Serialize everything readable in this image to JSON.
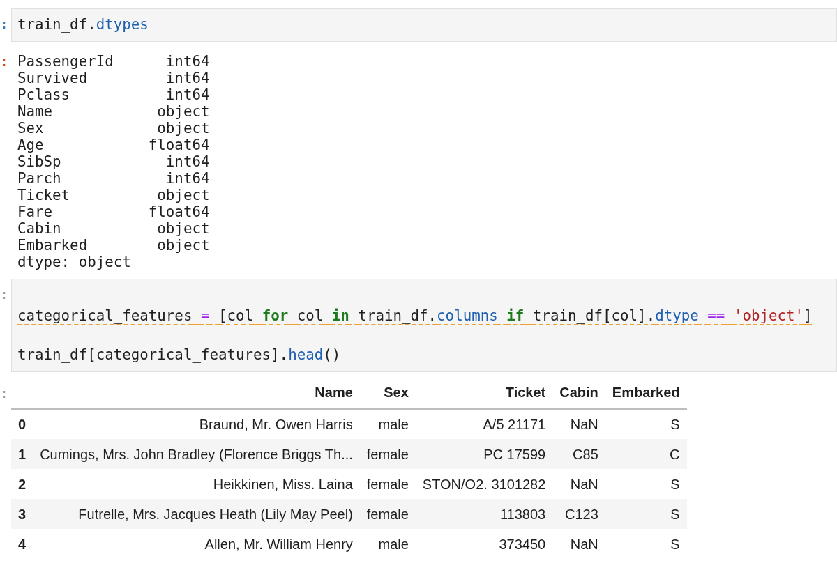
{
  "cells": [
    {
      "kind": "code",
      "prompt": ":",
      "color": "#307fc1",
      "lines": [
        {
          "lint_warning": false,
          "tokens": [
            {
              "kind": "plain",
              "text": "train_df."
            },
            {
              "kind": "attr",
              "text": "dtypes"
            }
          ]
        }
      ]
    },
    {
      "kind": "text_output",
      "prompt": ":",
      "color": "#d84315",
      "lines": [
        "PassengerId      int64",
        "Survived         int64",
        "Pclass           int64",
        "Name            object",
        "Sex             object",
        "Age            float64",
        "SibSp            int64",
        "Parch            int64",
        "Ticket          object",
        "Fare           float64",
        "Cabin           object",
        "Embarked        object",
        "dtype: object"
      ]
    },
    {
      "kind": "code",
      "prompt": ":",
      "color": "#9e9e9e",
      "lines": [
        {
          "blank_line_before": true,
          "lint_warning": true,
          "tokens": [
            {
              "kind": "plain",
              "text": "categorical_features",
              "space_after": true
            },
            {
              "kind": "operator",
              "text": "=",
              "space_after": true
            },
            {
              "kind": "plain",
              "text": "[col",
              "space_after": true
            },
            {
              "kind": "keyword",
              "text": "for",
              "space_after": true
            },
            {
              "kind": "plain",
              "text": "col",
              "space_after": true
            },
            {
              "kind": "keyword",
              "text": "in",
              "space_after": true
            },
            {
              "kind": "plain",
              "text": "train_df."
            },
            {
              "kind": "attr",
              "text": "columns",
              "space_after": true
            },
            {
              "kind": "keyword",
              "text": "if",
              "space_after": true
            },
            {
              "kind": "plain",
              "text": "train_df[col]."
            },
            {
              "kind": "attr",
              "text": "dtype",
              "space_after": true
            },
            {
              "kind": "operator",
              "text": "==",
              "space_after": true
            },
            {
              "kind": "string",
              "text": "'object'"
            },
            {
              "kind": "plain",
              "text": "]"
            }
          ]
        },
        {
          "blank_line_before": true,
          "lint_warning": false,
          "tokens": [
            {
              "kind": "plain",
              "text": "train_df[categorical_features]."
            },
            {
              "kind": "attr",
              "text": "head"
            },
            {
              "kind": "plain",
              "text": "()"
            }
          ]
        }
      ]
    },
    {
      "kind": "table_output",
      "prompt": ":",
      "color": "#9e9e9e",
      "columns": [
        "Name",
        "Sex",
        "Ticket",
        "Cabin",
        "Embarked"
      ],
      "rows": [
        {
          "index": "0",
          "cells": [
            "Braund, Mr. Owen Harris",
            "male",
            "A/5 21171",
            "NaN",
            "S"
          ]
        },
        {
          "index": "1",
          "cells": [
            "Cumings, Mrs. John Bradley (Florence Briggs Th...",
            "female",
            "PC 17599",
            "C85",
            "C"
          ]
        },
        {
          "index": "2",
          "cells": [
            "Heikkinen, Miss. Laina",
            "female",
            "STON/O2. 3101282",
            "NaN",
            "S"
          ]
        },
        {
          "index": "3",
          "cells": [
            "Futrelle, Mrs. Jacques Heath (Lily May Peel)",
            "female",
            "113803",
            "C123",
            "S"
          ]
        },
        {
          "index": "4",
          "cells": [
            "Allen, Mr. William Henry",
            "male",
            "373450",
            "NaN",
            "S"
          ]
        }
      ]
    }
  ]
}
